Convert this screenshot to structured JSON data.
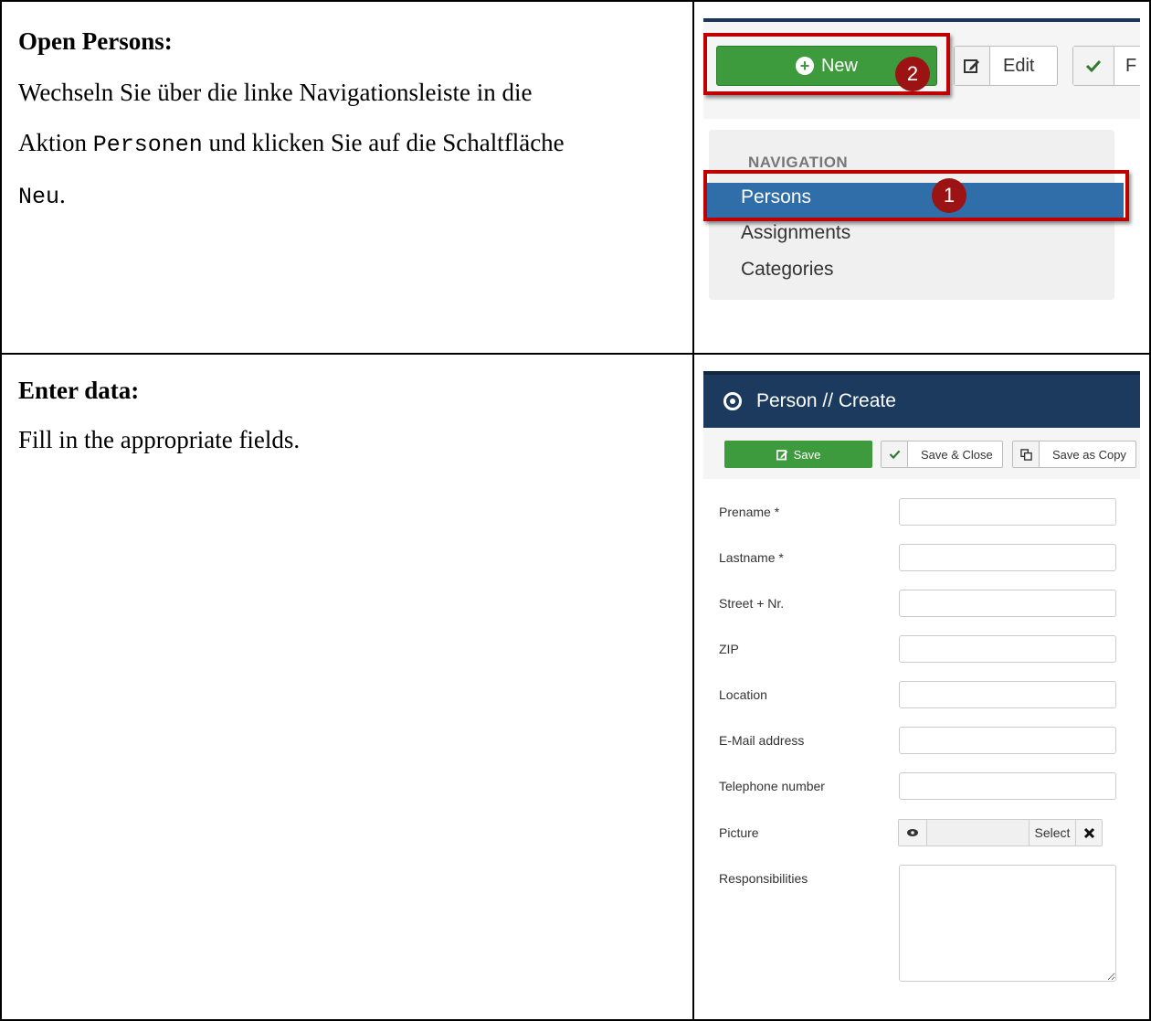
{
  "section1": {
    "heading": "Open Persons:",
    "text_a": "Wechseln Sie über die linke Navigationsleiste in die",
    "text_b": "Aktion ",
    "code_personen": "Personen",
    "text_c": " und klicken Sie auf die Schaltfläche",
    "code_neu": "Neu",
    "text_d": "."
  },
  "section2": {
    "heading": "Enter data:",
    "text": "Fill in the appropriate fields."
  },
  "shot1": {
    "toolbar": {
      "new_label": "New",
      "edit_label": "Edit",
      "next_label": "F"
    },
    "badges": {
      "new": "2",
      "persons": "1"
    },
    "nav": {
      "header": "NAVIGATION",
      "items": [
        "Persons",
        "Assignments",
        "Categories"
      ]
    },
    "colors": {
      "highlight": "#c00000",
      "nav_selected": "#2f6ea8",
      "new_button": "#3d9a3d"
    }
  },
  "shot2": {
    "title": "Person // Create",
    "toolbar": {
      "save_label": "Save",
      "save_close_label": "Save & Close",
      "save_copy_label": "Save as Copy"
    },
    "fields": [
      {
        "label": "Prename *",
        "value": ""
      },
      {
        "label": "Lastname *",
        "value": ""
      },
      {
        "label": "Street + Nr.",
        "value": ""
      },
      {
        "label": "ZIP",
        "value": ""
      },
      {
        "label": "Location",
        "value": ""
      },
      {
        "label": "E-Mail address",
        "value": ""
      },
      {
        "label": "Telephone number",
        "value": ""
      }
    ],
    "picture": {
      "label": "Picture",
      "select_label": "Select"
    },
    "responsibilities": {
      "label": "Responsibilities",
      "value": ""
    },
    "colors": {
      "titlebar": "#1c3a5e"
    }
  }
}
